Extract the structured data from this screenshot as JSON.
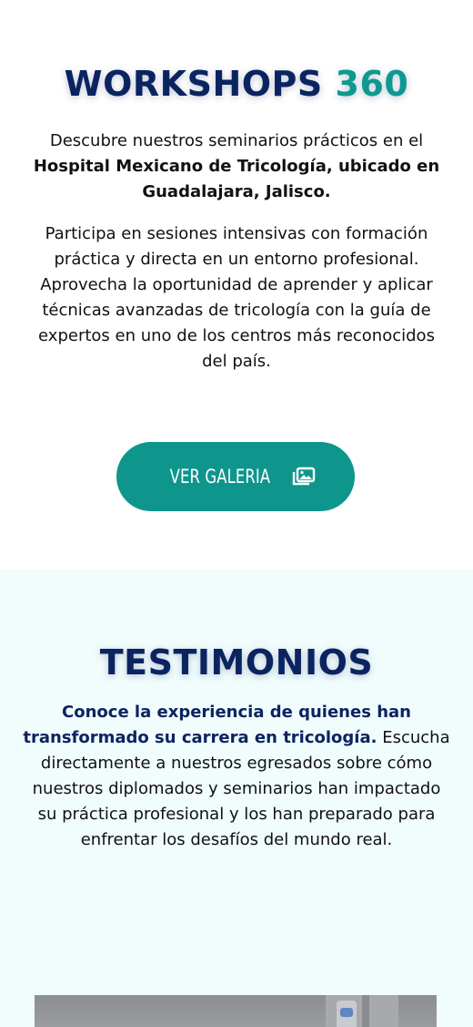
{
  "workshops": {
    "title_main": "WORKSHOPS",
    "title_accent": "360",
    "intro_plain": "Descubre nuestros seminarios prácticos en el",
    "intro_bold": "Hospital Mexicano de Tricología, ubicado en Guadalajara, Jalisco.",
    "body": "Participa en sesiones intensivas con formación práctica y directa en un entorno profesional. Aprovecha la oportunidad de aprender y aplicar técnicas avanzadas de tricología con la guía de expertos en uno de los centros más reconocidos del país.",
    "button_label": "VER GALERIA",
    "button_icon": "gallery-icon"
  },
  "testimonios": {
    "title": "TESTIMONIOS",
    "lead_bold": "Conoce la experiencia de quienes han transformado su carrera en tricología.",
    "lead_plain": "Escucha directamente a nuestros egresados sobre cómo nuestros diplomados y seminarios han impactado su práctica profesional y los han preparado para enfrentar los desafíos del mundo real."
  },
  "colors": {
    "navy": "#0b2460",
    "teal": "#0e9990",
    "button": "#0f968c",
    "section_bg": "#f1fcfd"
  }
}
